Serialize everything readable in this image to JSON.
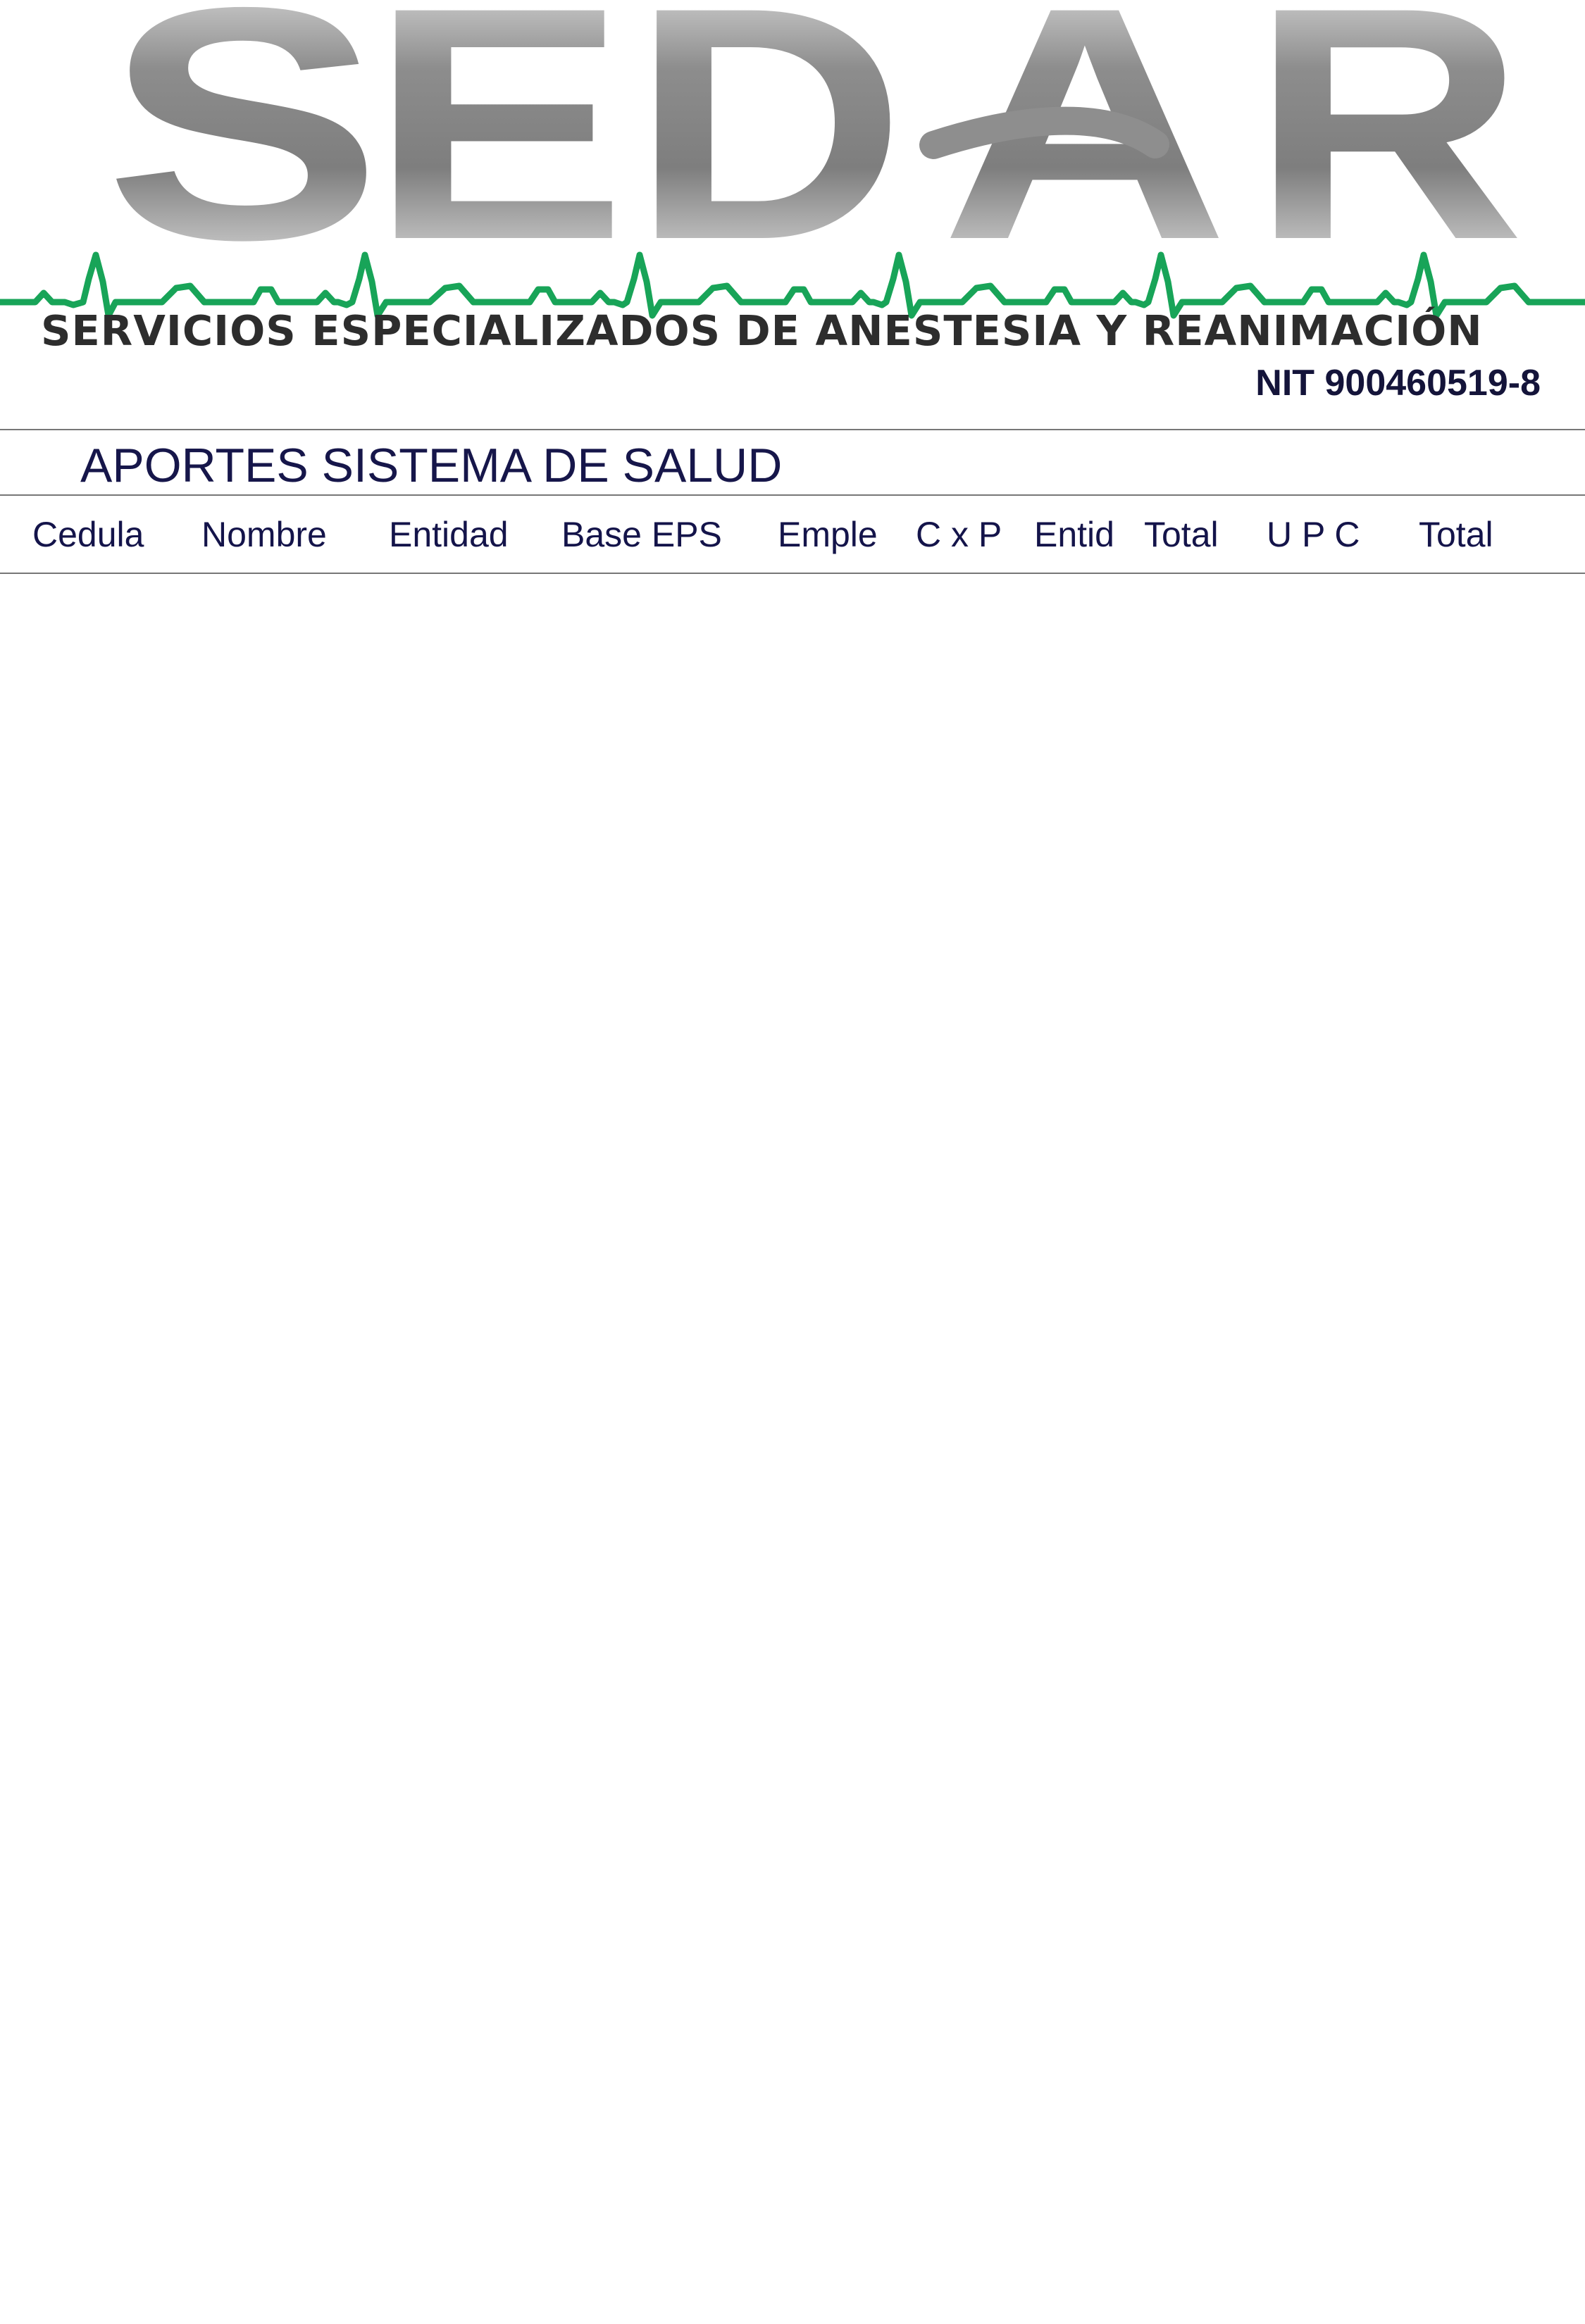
{
  "company": {
    "logo_word": "SEDAR",
    "logo_letters": [
      "S",
      "E",
      "D",
      "A",
      "R"
    ],
    "subtitle": "SERVICIOS ESPECIALIZADOS DE ANESTESIA Y REANIMACIÓN",
    "nit_label": "NIT",
    "nit_number": "900460519-8"
  },
  "report": {
    "title": "APORTES SISTEMA DE SALUD"
  },
  "table": {
    "columns": [
      "Cedula",
      "Nombre",
      "Entidad",
      "Base EPS",
      "Emple",
      "C x P",
      "Entid",
      "Total",
      "U P C",
      "Total"
    ],
    "rows": []
  },
  "colors": {
    "logo_gray_dark": "#808080",
    "logo_gray_light": "#eeeeee",
    "heartbeat_green": "#18a458",
    "subtitle_text": "#2d2d2d",
    "title_text": "#16164a",
    "rule": "#777777"
  }
}
